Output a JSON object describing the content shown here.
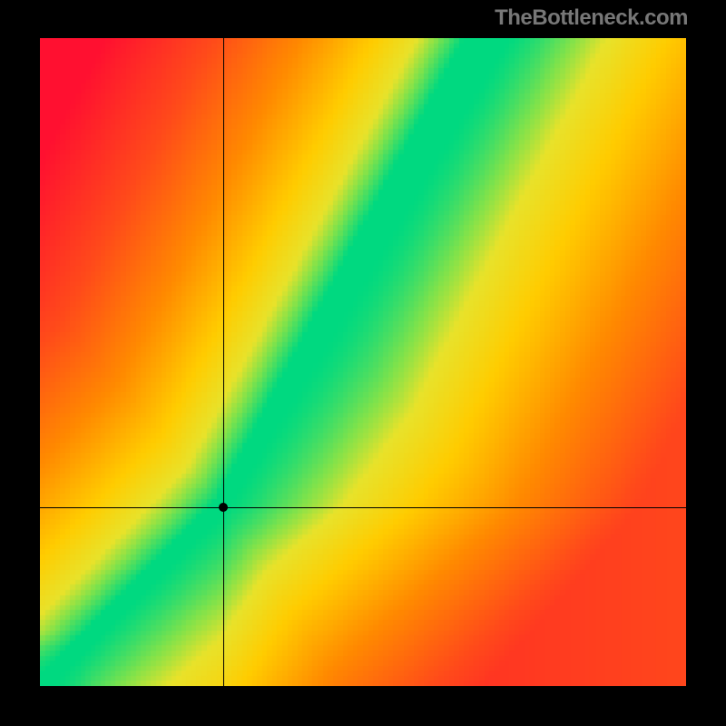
{
  "watermark": "TheBottleneck.com",
  "chart_data": {
    "type": "heatmap",
    "title": "",
    "xlabel": "",
    "ylabel": "",
    "xlim": [
      0,
      1
    ],
    "ylim": [
      0,
      1
    ],
    "crosshair": {
      "x": 0.284,
      "y": 0.276
    },
    "marker": {
      "x": 0.284,
      "y": 0.276
    },
    "optimal_curve": {
      "description": "green optimal band; below kink it is roughly linear y≈x, above kink slope ≈1.75",
      "kink": {
        "x": 0.28,
        "y": 0.28
      },
      "segments": [
        {
          "x0": 0.0,
          "y0": 0.0,
          "x1": 0.28,
          "y1": 0.28
        },
        {
          "x0": 0.28,
          "y0": 0.28,
          "x1": 0.69,
          "y1": 1.0
        }
      ],
      "band_halfwidth_low": 0.015,
      "band_halfwidth_high": 0.045
    },
    "gradient": {
      "scheme": "red-orange-yellow-green by distance from optimal curve; far right drifts back toward yellow/orange",
      "stops": [
        {
          "t": 0.0,
          "color": "#00d980"
        },
        {
          "t": 0.07,
          "color": "#7fe24b"
        },
        {
          "t": 0.13,
          "color": "#e8e22a"
        },
        {
          "t": 0.25,
          "color": "#ffcc00"
        },
        {
          "t": 0.45,
          "color": "#ff8a00"
        },
        {
          "t": 0.7,
          "color": "#ff4a1a"
        },
        {
          "t": 1.0,
          "color": "#ff1030"
        }
      ]
    },
    "resolution": 128
  }
}
